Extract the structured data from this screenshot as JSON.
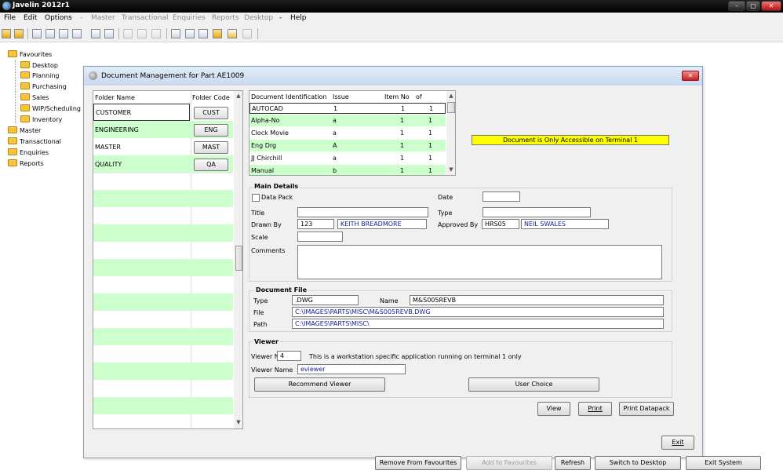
{
  "window": {
    "title": "Javelin 2012r1",
    "min": "–",
    "max": "▢",
    "close": "✕"
  },
  "menu": [
    {
      "label": "File",
      "enabled": true
    },
    {
      "label": "Edit",
      "enabled": true
    },
    {
      "label": "Options",
      "enabled": true
    },
    {
      "label": "-",
      "enabled": false
    },
    {
      "label": "Master",
      "enabled": false
    },
    {
      "label": "Transactional",
      "enabled": false
    },
    {
      "label": "Enquiries",
      "enabled": false
    },
    {
      "label": "Reports",
      "enabled": false
    },
    {
      "label": "Desktop",
      "enabled": false
    },
    {
      "label": "-",
      "enabled": true
    },
    {
      "label": "Help",
      "enabled": true
    }
  ],
  "tree": {
    "favourites": "Favourites",
    "children": [
      "Desktop",
      "Planning",
      "Purchasing",
      "Sales",
      "WIP/Scheduling",
      "Inventory"
    ],
    "roots": [
      "Master",
      "Transactional",
      "Enquiries",
      "Reports"
    ]
  },
  "dialog": {
    "title": "Document Management for Part AE1009",
    "close": "✕"
  },
  "folders": {
    "headers": {
      "name": "Folder Name",
      "code": "Folder Code"
    },
    "rows": [
      {
        "name": "CUSTOMER",
        "code": "CUST"
      },
      {
        "name": "ENGINEERING",
        "code": "ENG"
      },
      {
        "name": "MASTER",
        "code": "MAST"
      },
      {
        "name": "QUALITY",
        "code": "QA"
      }
    ]
  },
  "documents": {
    "headers": {
      "id": "Document Identification",
      "issue": "Issue",
      "item": "Item No",
      "of": "of"
    },
    "rows": [
      {
        "id": "AUTOCAD",
        "issue": "1",
        "item": "1",
        "of": "1"
      },
      {
        "id": "Alpha-No",
        "issue": "a",
        "item": "1",
        "of": "1"
      },
      {
        "id": "Clock Movie",
        "issue": "a",
        "item": "1",
        "of": "1"
      },
      {
        "id": "Eng Drg",
        "issue": "A",
        "item": "1",
        "of": "1"
      },
      {
        "id": "JJ Chirchill",
        "issue": "a",
        "item": "1",
        "of": "1"
      },
      {
        "id": "Manual",
        "issue": "b",
        "item": "1",
        "of": "1"
      }
    ]
  },
  "notice": "Document is Only Accessible on Terminal  1",
  "main_details": {
    "title": "Main Details",
    "data_pack": "Data Pack",
    "date_label": "Date",
    "date": "",
    "title_label": "Title",
    "title_value": "",
    "type_label": "Type",
    "type_value": "",
    "drawn_by_label": "Drawn By",
    "drawn_by_code": "123",
    "drawn_by_name": "KEITH BREADMORE",
    "approved_by_label": "Approved By",
    "approved_by_code": "HRS05",
    "approved_by_name": "NEIL SWALES",
    "scale_label": "Scale",
    "scale": "",
    "comments_label": "Comments",
    "comments": ""
  },
  "document_file": {
    "title": "Document File",
    "type_label": "Type",
    "type": ".DWG",
    "name_label": "Name",
    "name": "M&S005REVB",
    "file_label": "File",
    "file": "C:\\IMAGES\\PARTS\\MISC\\M&S005REVB.DWG",
    "path_label": "Path",
    "path": "C:\\IMAGES\\PARTS\\MISC\\"
  },
  "viewer": {
    "title": "Viewer",
    "no_label": "Viewer No.",
    "no": "4",
    "note": "This is a workstation specific application running on terminal  1 only",
    "name_label": "Viewer Name",
    "name": "eviewer",
    "recommend": "Recommend Viewer",
    "user_choice": "User Choice"
  },
  "actions": {
    "view": "View",
    "print": "Print",
    "print_datapack": "Print Datapack",
    "exit": "Exit"
  },
  "footer": {
    "remove_fav": "Remove From Favourites",
    "add_fav": "Add to Favourites",
    "refresh": "Refresh",
    "switch_desktop": "Switch to Desktop",
    "exit_system": "Exit System"
  },
  "colors": {
    "row_alt": "#ccffcc",
    "notice_bg": "#ffff00",
    "field_text": "#1a1a9a"
  },
  "toolbar_icons": [
    "open-folder-icon",
    "open-file-icon",
    "form-icon",
    "split-form-icon",
    "list-form-icon",
    "grid-form-icon",
    "detail-form-icon",
    "list-icon",
    "disabled-save-icon",
    "disabled-table-icon",
    "disabled-notes-icon",
    "link-icon",
    "export-icon",
    "import-icon",
    "lock-open-icon",
    "flag-icon",
    "new-window-icon"
  ]
}
